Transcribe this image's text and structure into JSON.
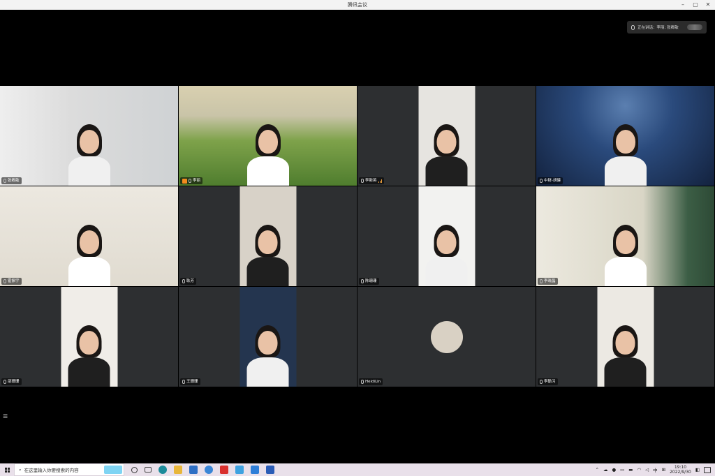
{
  "window": {
    "title": "腾讯会议",
    "minimize": "–",
    "restore": "▢",
    "close": "✕"
  },
  "speaking": {
    "label": "正在讲话：李丽; 张卿歆"
  },
  "participants": [
    {
      "name": "张卿歆",
      "bg": "#d9dadc",
      "style": "room"
    },
    {
      "name": "李丽",
      "bg": "#7aa54a",
      "style": "landscape",
      "host": true
    },
    {
      "name": "李新英",
      "bg": "#e6e4e0",
      "style": "narrow",
      "signal": true
    },
    {
      "name": "中财-胡健",
      "bg": "#223a63",
      "style": "stars"
    },
    {
      "name": "霍振宇",
      "bg": "#e7e4de",
      "style": "shelf"
    },
    {
      "name": "耿芳",
      "bg": "#d8d2c8",
      "style": "narrow"
    },
    {
      "name": "陈珊珊",
      "bg": "#f2f2f0",
      "style": "narrow"
    },
    {
      "name": "李晓晶",
      "bg": "#d9dcd2",
      "style": "full-room"
    },
    {
      "name": "邵珊珊",
      "bg": "#f0ede8",
      "style": "narrow"
    },
    {
      "name": "王珊珊",
      "bg": "#24354f",
      "style": "narrow"
    },
    {
      "name": "HeidiLin",
      "bg": "#2d2f31",
      "style": "avatar"
    },
    {
      "name": "李勤习",
      "bg": "#ece9e3",
      "style": "narrow"
    }
  ],
  "taskbar": {
    "search_placeholder": "在这里输入你要搜索的内容",
    "ime": "中",
    "time": "19:10",
    "date": "2022/9/30"
  },
  "colors": {
    "accent": "#f28b1e",
    "tile_bg": "#2d2f31"
  }
}
